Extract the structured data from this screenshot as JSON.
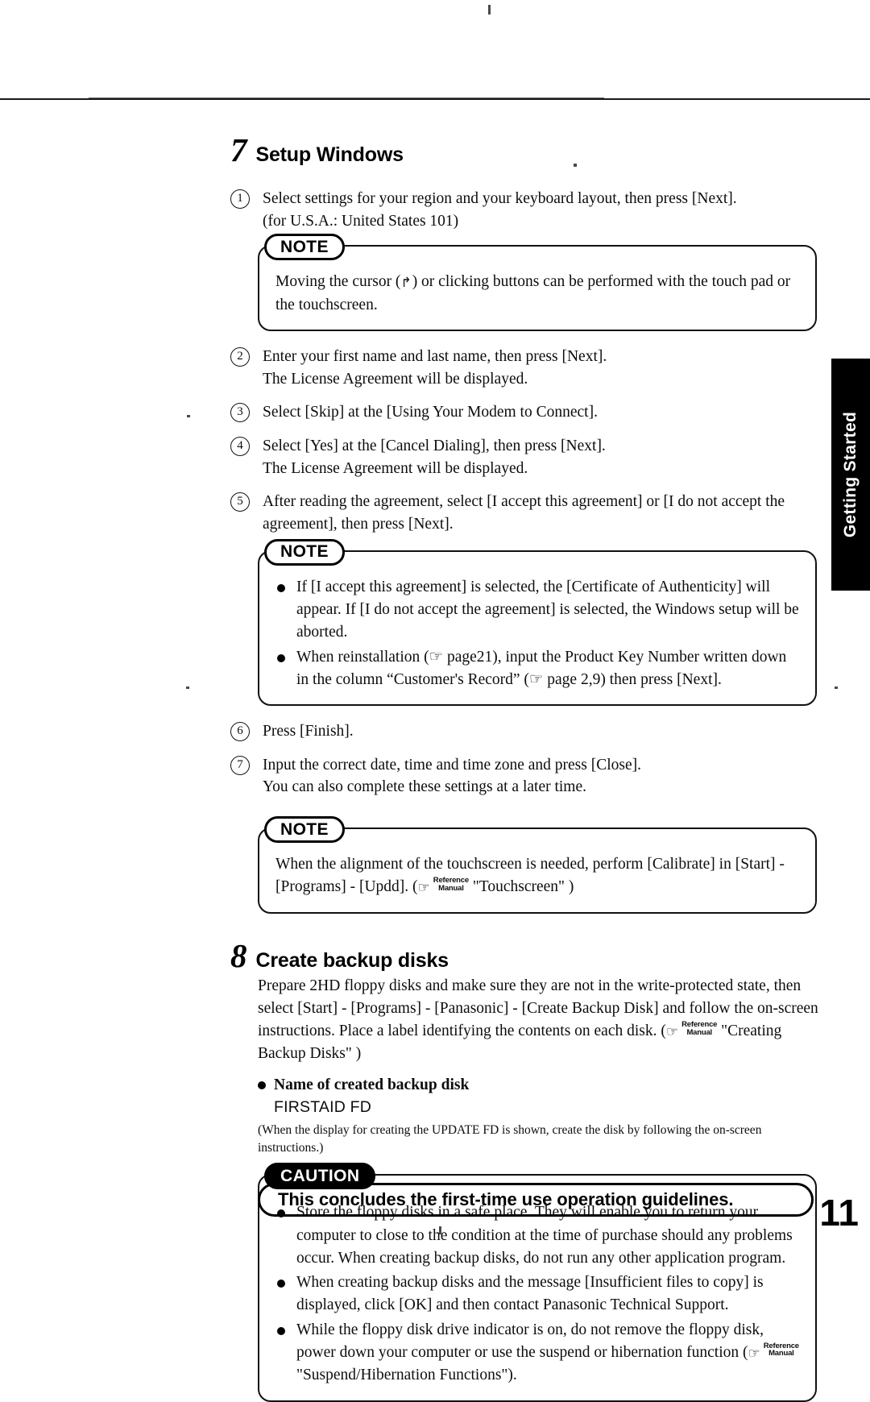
{
  "page": {
    "number": "11",
    "side_tab": "Getting Started"
  },
  "step7": {
    "number": "7",
    "title": "Setup Windows",
    "items": [
      {
        "marker": "1",
        "lines": [
          "Select settings for your region and your keyboard layout, then press [Next].",
          "(for U.S.A.: United States 101)"
        ]
      },
      {
        "marker": "2",
        "lines": [
          "Enter your first name and last name, then press [Next].",
          "The License Agreement will be displayed."
        ]
      },
      {
        "marker": "3",
        "lines": [
          "Select [Skip] at the [Using Your Modem to Connect]."
        ]
      },
      {
        "marker": "4",
        "lines": [
          "Select [Yes] at the [Cancel Dialing], then press [Next].",
          "The License Agreement will be displayed."
        ]
      },
      {
        "marker": "5",
        "lines": [
          "After reading the agreement, select [I accept this agreement] or [I do not accept the agreement], then press [Next]."
        ]
      },
      {
        "marker": "6",
        "lines": [
          "Press [Finish]."
        ]
      },
      {
        "marker": "7",
        "lines": [
          "Input the correct date, time and time zone and press [Close].",
          "You can also complete these settings at a later time."
        ]
      }
    ]
  },
  "note1": {
    "badge": "NOTE",
    "text_before_cursor": "Moving the cursor (",
    "cursor_icon": "mouse-pointer-icon",
    "cursor_glyph": "↱",
    "text_after_cursor": ") or clicking buttons can be performed with the touch pad or the touchscreen."
  },
  "note2": {
    "badge": "NOTE",
    "bullets": [
      "If [I accept this agreement] is selected, the [Certificate of Authenticity] will appear.  If [I do not accept the agreement] is selected, the Windows setup will be aborted.",
      "When reinstallation (☞ page21), input the Product Key Number written down in the column “Customer's Record”  (☞ page 2,9) then press [Next]."
    ]
  },
  "note3": {
    "badge": "NOTE",
    "text_part1": "When the alignment of the touchscreen is needed, perform [Calibrate] in [Start] - [Programs] - [Updd].  (",
    "ref_icon": "pointing-hand-icon",
    "ref_line1": "Reference",
    "ref_line2": "Manual",
    "text_part2": "\"Touchscreen\" )"
  },
  "step8": {
    "number": "8",
    "title": "Create backup disks",
    "body_part1": "Prepare 2HD floppy disks and make sure they are not in the write-protected state, then select [Start] - [Programs] - [Panasonic] - [Create Backup Disk] and follow the on-screen instructions.  Place a label identifying the contents on each disk. (",
    "ref_icon": "pointing-hand-icon",
    "ref_line1": "Reference",
    "ref_line2": "Manual",
    "body_part2": "\"Creating Backup Disks\" )",
    "sub_bullet": "Name of created backup disk",
    "disk_name": "FIRSTAID FD",
    "fine_print": "(When the display for creating the UPDATE FD is shown, create the disk by following the on-screen instructions.)"
  },
  "caution": {
    "badge": "CAUTION",
    "bullets": [
      {
        "text": "Store the floppy disks in a safe place. They will enable you to return your computer to close to the condition at the time of purchase should any problems occur. When creating backup disks, do not run any other application program."
      },
      {
        "text": "When creating backup disks and the message [Insufficient files to copy] is displayed, click [OK] and then contact Panasonic Technical Support."
      },
      {
        "text_part1": "While the floppy disk drive indicator is on, do not remove the floppy disk, power down your computer or use the suspend or hibernation function (",
        "ref_icon": "pointing-hand-icon",
        "ref_line1": "Reference",
        "ref_line2": "Manual",
        "text_part2": "\"Suspend/Hibernation Functions\")."
      }
    ]
  },
  "conclusion": {
    "text": "This concludes the first-time use operation guidelines."
  },
  "colors": {
    "ink": "#0d0d0d",
    "tab_background": "#000000",
    "tab_text": "#ffffff",
    "paper": "#ffffff"
  }
}
